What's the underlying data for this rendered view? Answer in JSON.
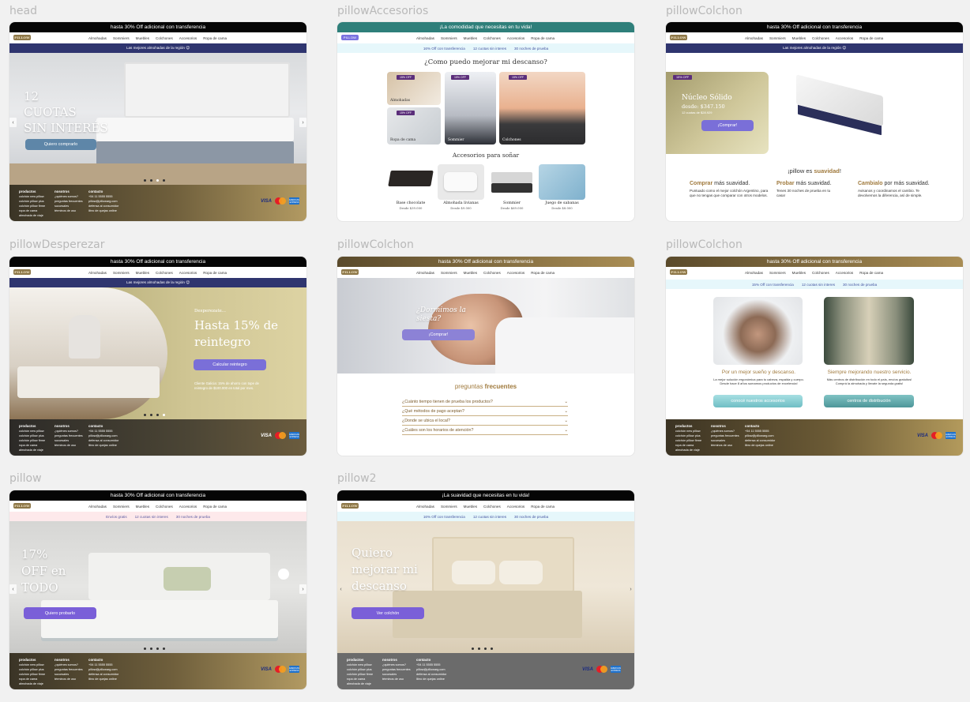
{
  "frame_labels": {
    "head": "head",
    "accesorios": "pillowAccesorios",
    "colchon1": "pillowColchon",
    "desperezar": "pillowDesperezar",
    "colchon2": "pillowColchon",
    "colchon3": "pillowColchon",
    "pillow": "pillow",
    "pillow2": "pillow2"
  },
  "common": {
    "topbar_30": "hasta 30% Off adicional con transferencia",
    "logo": "PILLOW",
    "nav": [
      "Almohadas",
      "Sommiers",
      "Muebles",
      "Colchones",
      "Accesorios",
      "Ropa de cama"
    ],
    "region_strip": "Las mejores almohadas de la región 😊",
    "benefits": [
      "15% Off con transferencia",
      "12 cuotas sin interes",
      "30 noches de prueba"
    ],
    "footer": {
      "productos": "productos",
      "nosotros": "nosotros",
      "contacto": "contacto",
      "productos_items": [
        "colchón new pillow",
        "colchón pillow plus",
        "colchón pillow firme",
        "ropa de cama",
        "almohada de viaje"
      ],
      "nosotros_items": [
        "¿quiénes somos?",
        "preguntas frecuentes",
        "sucursales",
        "términos de uso"
      ],
      "contacto_items": [
        "+54 11 5555 5555",
        "pillow@pillowarg.com",
        "defensa al consumidor",
        "libro de quejas online"
      ],
      "payments": [
        "VISA",
        "AMERICAN EXPRESS"
      ]
    }
  },
  "head": {
    "hero_title": "12\nCUOTAS\nSIN INTERÉS",
    "hero_button": "Quiero comprarlo"
  },
  "accesorios": {
    "topbar": "¡La comodidad que necesitas en tu vida!",
    "benefits": [
      "16% Off con transferencia",
      "12 cuotas sin interes",
      "30 noches de prueba"
    ],
    "title": "¿Como puedo mejorar mi descanso?",
    "tiles": [
      {
        "badge": "15% OFF",
        "label": "Almohadas"
      },
      {
        "badge": "15% OFF",
        "label": "Sommier"
      },
      {
        "badge": "15% OFF",
        "label": "Colchones"
      },
      {
        "badge": "15% OFF",
        "label": "Ropa de cama"
      }
    ],
    "subtitle": "Accesorios para soñar",
    "products": [
      {
        "name": "Base chocolate",
        "price": "Desde $39.000"
      },
      {
        "name": "Almohada livianas",
        "price": "Desde $9.000"
      },
      {
        "name": "Sommier",
        "price": "Desde $69.000"
      },
      {
        "name": "Juego de sabanas",
        "price": "Desde $8.000"
      }
    ]
  },
  "colchon1": {
    "badge": "15% OFF",
    "title": "Núcleo Sólido",
    "price": "desde: $347.150",
    "cuotas": "12 cuotas de $28.929",
    "button": "¡Comprar!",
    "suavidad_pre": "¡pillow es ",
    "suavidad_bold": "suavidad",
    "suavidad_post": "!",
    "features": [
      {
        "bold": "Comprar",
        "rest": " más suavidad.",
        "desc": "Puntuado como el mejor colchón Argentino, para que no tengas que comparar con otros modelos."
      },
      {
        "bold": "Probar",
        "rest": " más suavidad.",
        "desc": "Tenes 30 noches de prueba en tu casa!"
      },
      {
        "bold": "Cambialo",
        "rest": " por más suavidad.",
        "desc": "Avisanos y coordinamos el cambio. Te devolvemos la diferencia, así de simple."
      }
    ]
  },
  "desperezar": {
    "pre": "Desperezate...",
    "title": "Hasta 15% de reintegro",
    "button": "Calcular reintegro",
    "note": "Cliente Galicia: 15% de ahorro con tope de reintegro de $100.000 en total por mes."
  },
  "colchon2": {
    "hero_text": "¿Dormimos la siesta?",
    "button": "¡Comprar!",
    "faq_pre": "preguntas ",
    "faq_bold": "frecuentes",
    "faqs": [
      "¿Cuánto tiempo tienen de prueba los productos?",
      "¿Qué métodos de pago aceptan?",
      "¿Donde se ubica el local?",
      "¿Cuáles son los horarios de atención?"
    ]
  },
  "colchon3": {
    "benefits": [
      "15% Off con transferencia",
      "12 cuotas sin interes",
      "30 noches de prueba"
    ],
    "col1_title": "Por un mejor sueño y descanso.",
    "col1_desc": "La mejor solución ergonómica para tu cabeza, espalda y cuerpo. Desde hace 8 años sumamos productos de excelencia!",
    "col1_button": "conocé nuestros accesorios",
    "col2_title": "Siempre mejorando nuestro servicio.",
    "col2_desc": "Más centros de distribución en todo el país, envíos gratuitos! Comprá la almohada y llevate la segunda gratis!",
    "col2_button": "centros de distribución"
  },
  "pillow": {
    "benefits": [
      "Envíos gratis",
      "12 cuotas sin interes",
      "30 noches de prueba"
    ],
    "hero_title": "17%\nOFF en\nTODO",
    "button": "Quiero probarlo"
  },
  "pillow2": {
    "topbar": "¡La suavidad que necesitas en tu vida!",
    "benefits": [
      "16% Off con transferencia",
      "12 cuotas sin interes",
      "30 noches de prueba"
    ],
    "hero_title": "Quiero\nmejorar mi\ndescanso",
    "button": "Ver colchón"
  },
  "colors": {
    "navy": "#2f356f",
    "purple_button": "#7a6fd8",
    "gold": "#a98d54",
    "teal": "#2f7f7a"
  }
}
